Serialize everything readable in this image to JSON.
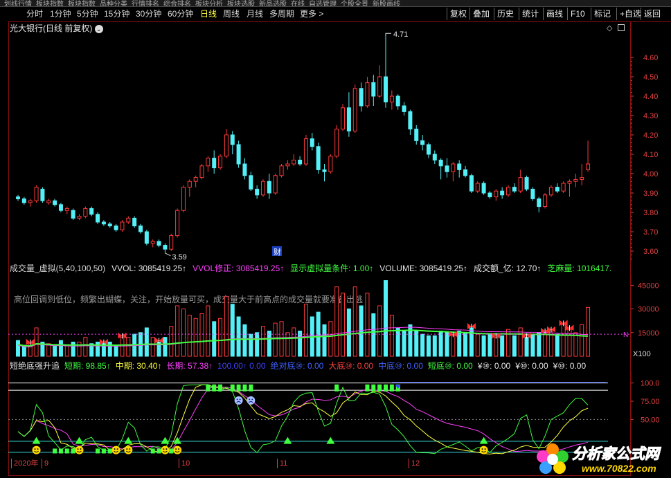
{
  "topbar": {
    "items": [
      "划线行情",
      "板块指数",
      "板块指数",
      "品种分类",
      "行情排名",
      "综合排名",
      "板块分析",
      "板块选股",
      "新品选股",
      "在线",
      "自选管理",
      "个股全景",
      "新股画线"
    ]
  },
  "period_bar": {
    "items": [
      "分时",
      "1分钟",
      "5分钟",
      "15分钟",
      "30分钟",
      "60分钟",
      "日线",
      "周线",
      "月线",
      "多周期",
      "更多 >"
    ],
    "active": "日线"
  },
  "right_buttons": [
    "复权",
    "叠加",
    "历史",
    "统计",
    "画线",
    "F10",
    "标记",
    "+自选",
    "返回"
  ],
  "main_panel": {
    "title": "光大银行(日线 前复权)",
    "high_label": "4.71",
    "low_label": "3.59",
    "badge": "财",
    "y_ticks": [
      "4.60",
      "4.50",
      "4.40",
      "4.30",
      "4.20",
      "4.10",
      "4.00",
      "3.90",
      "3.80",
      "3.70",
      "3.60"
    ]
  },
  "volume_panel": {
    "title_parts": [
      {
        "text": "成交量_虚拟(5,40,100,50)",
        "color": "#d8d8d8"
      },
      {
        "text": "VVOL: 3085419.25↑",
        "color": "#e8e8e8"
      },
      {
        "text": "VVOL修正: 3085419.25↑",
        "color": "#ff40ff"
      },
      {
        "text": "显示虚拟量条件: 1.00↑",
        "color": "#40ff40"
      },
      {
        "text": "VOLUME: 3085419.25↑",
        "color": "#e8e8e8"
      },
      {
        "text": "成交额_亿: 12.70↑",
        "color": "#e8e8e8"
      },
      {
        "text": "芝麻量: 1016417.",
        "color": "#40ff40"
      }
    ],
    "note": "高位回调到低位，频繁出蝴蝶，关注，开始放量可买，成交量大于前高点的成交量就要准备出逃",
    "y_ticks": [
      "45000",
      "30000",
      "15000"
    ],
    "unit": "X100",
    "marker": "N"
  },
  "indicator_panel": {
    "title_parts": [
      {
        "text": "短绝底强升追",
        "color": "#e8e8e8"
      },
      {
        "text": "短期: 98.85↑",
        "color": "#40ff40"
      },
      {
        "text": "中期: 30.40↑",
        "color": "#ffff40"
      },
      {
        "text": "长期: 57.38↑",
        "color": "#ff40ff"
      },
      {
        "text": "100.00↑ 0.00",
        "color": "#4040ff"
      },
      {
        "text": "绝对底⑩: 0.00",
        "color": "#4060ff"
      },
      {
        "text": "大底⑩: 0.00",
        "color": "#ff4040"
      },
      {
        "text": "中底⑩: 0.00",
        "color": "#4060ff"
      },
      {
        "text": "短底⑩: 0.00",
        "color": "#40ff40"
      },
      {
        "text": "¥⑩: 0.00",
        "color": "#e8e8e8"
      },
      {
        "text": "¥⑩: 0.00",
        "color": "#e8e8e8"
      },
      {
        "text": "¥⑩: 0.00",
        "color": "#e8e8e8"
      }
    ],
    "y_ticks": [
      "100.0",
      "75.00",
      "50.00"
    ]
  },
  "date_axis": {
    "labels": [
      "2020年",
      "9",
      "10",
      "11",
      "12"
    ]
  },
  "watermark": {
    "name": "分析家公式网",
    "url": "www.70822.com"
  },
  "colors": {
    "up": "#ff3b3b",
    "down": "#54f0f8",
    "frame": "#8a0f0f",
    "axis_text": "#e04040"
  },
  "chart_data": {
    "type": "candlestick",
    "ohlc": [
      [
        3.88,
        3.89,
        3.86,
        3.87
      ],
      [
        3.87,
        3.88,
        3.84,
        3.85
      ],
      [
        3.85,
        3.87,
        3.83,
        3.86
      ],
      [
        3.86,
        3.94,
        3.85,
        3.93
      ],
      [
        3.92,
        3.93,
        3.85,
        3.86
      ],
      [
        3.85,
        3.87,
        3.84,
        3.86
      ],
      [
        3.86,
        3.87,
        3.83,
        3.84
      ],
      [
        3.84,
        3.85,
        3.8,
        3.81
      ],
      [
        3.81,
        3.83,
        3.79,
        3.82
      ],
      [
        3.81,
        3.82,
        3.76,
        3.77
      ],
      [
        3.77,
        3.79,
        3.76,
        3.78
      ],
      [
        3.78,
        3.83,
        3.77,
        3.82
      ],
      [
        3.82,
        3.83,
        3.78,
        3.79
      ],
      [
        3.79,
        3.8,
        3.74,
        3.75
      ],
      [
        3.75,
        3.76,
        3.73,
        3.74
      ],
      [
        3.74,
        3.75,
        3.72,
        3.73
      ],
      [
        3.73,
        3.74,
        3.7,
        3.71
      ],
      [
        3.71,
        3.76,
        3.7,
        3.75
      ],
      [
        3.75,
        3.78,
        3.74,
        3.77
      ],
      [
        3.77,
        3.78,
        3.72,
        3.73
      ],
      [
        3.73,
        3.74,
        3.69,
        3.7
      ],
      [
        3.7,
        3.71,
        3.63,
        3.64
      ],
      [
        3.64,
        3.66,
        3.62,
        3.65
      ],
      [
        3.65,
        3.66,
        3.62,
        3.63
      ],
      [
        3.63,
        3.64,
        3.59,
        3.61
      ],
      [
        3.61,
        3.69,
        3.6,
        3.68
      ],
      [
        3.68,
        3.82,
        3.67,
        3.81
      ],
      [
        3.81,
        3.94,
        3.8,
        3.93
      ],
      [
        3.93,
        3.97,
        3.88,
        3.96
      ],
      [
        3.96,
        3.99,
        3.93,
        3.98
      ],
      [
        3.98,
        4.05,
        3.97,
        4.04
      ],
      [
        4.04,
        4.09,
        4.01,
        4.08
      ],
      [
        4.08,
        4.12,
        4.0,
        4.03
      ],
      [
        4.03,
        4.1,
        4.02,
        4.09
      ],
      [
        4.09,
        4.23,
        4.08,
        4.2
      ],
      [
        4.2,
        4.22,
        4.1,
        4.15
      ],
      [
        4.15,
        4.17,
        4.03,
        4.05
      ],
      [
        4.05,
        4.08,
        3.97,
        3.99
      ],
      [
        3.99,
        4.01,
        3.91,
        3.92
      ],
      [
        3.92,
        3.94,
        3.87,
        3.89
      ],
      [
        3.89,
        3.97,
        3.88,
        3.96
      ],
      [
        3.96,
        4.0,
        3.87,
        3.9
      ],
      [
        3.9,
        4.0,
        3.89,
        3.99
      ],
      [
        3.99,
        4.05,
        3.98,
        4.04
      ],
      [
        4.04,
        4.07,
        4.02,
        4.05
      ],
      [
        4.05,
        4.1,
        4.04,
        4.07
      ],
      [
        4.07,
        4.09,
        4.04,
        4.05
      ],
      [
        4.05,
        4.2,
        4.04,
        4.18
      ],
      [
        4.18,
        4.21,
        4.12,
        4.14
      ],
      [
        4.14,
        4.16,
        4.0,
        4.02
      ],
      [
        4.02,
        4.05,
        3.96,
        4.01
      ],
      [
        4.01,
        4.1,
        4.0,
        4.09
      ],
      [
        4.09,
        4.25,
        4.08,
        4.23
      ],
      [
        4.23,
        4.36,
        4.22,
        4.34
      ],
      [
        4.34,
        4.42,
        4.19,
        4.22
      ],
      [
        4.22,
        4.46,
        4.21,
        4.44
      ],
      [
        4.44,
        4.47,
        4.32,
        4.35
      ],
      [
        4.35,
        4.5,
        4.34,
        4.47
      ],
      [
        4.47,
        4.51,
        4.35,
        4.4
      ],
      [
        4.4,
        4.56,
        4.39,
        4.5
      ],
      [
        4.5,
        4.71,
        4.34,
        4.37
      ],
      [
        4.37,
        4.43,
        4.33,
        4.4
      ],
      [
        4.4,
        4.41,
        4.33,
        4.35
      ],
      [
        4.35,
        4.37,
        4.3,
        4.32
      ],
      [
        4.32,
        4.33,
        4.2,
        4.23
      ],
      [
        4.23,
        4.25,
        4.15,
        4.17
      ],
      [
        4.17,
        4.2,
        4.12,
        4.15
      ],
      [
        4.15,
        4.16,
        4.08,
        4.1
      ],
      [
        4.1,
        4.12,
        4.05,
        4.07
      ],
      [
        4.07,
        4.08,
        3.97,
        4.04
      ],
      [
        4.04,
        4.08,
        3.98,
        4.01
      ],
      [
        4.01,
        4.06,
        3.96,
        4.05
      ],
      [
        4.05,
        4.07,
        3.98,
        4.02
      ],
      [
        4.02,
        4.04,
        3.98,
        3.99
      ],
      [
        3.99,
        4.0,
        3.9,
        3.91
      ],
      [
        3.91,
        3.96,
        3.9,
        3.95
      ],
      [
        3.95,
        3.96,
        3.89,
        3.9
      ],
      [
        3.9,
        3.91,
        3.87,
        3.88
      ],
      [
        3.88,
        3.92,
        3.86,
        3.91
      ],
      [
        3.91,
        3.93,
        3.87,
        3.89
      ],
      [
        3.89,
        3.94,
        3.88,
        3.93
      ],
      [
        3.93,
        3.95,
        3.9,
        3.91
      ],
      [
        3.91,
        4.02,
        3.9,
        3.98
      ],
      [
        3.98,
        3.99,
        3.91,
        3.92
      ],
      [
        3.92,
        3.93,
        3.86,
        3.87
      ],
      [
        3.87,
        3.88,
        3.8,
        3.83
      ],
      [
        3.83,
        3.9,
        3.82,
        3.89
      ],
      [
        3.89,
        3.94,
        3.88,
        3.93
      ],
      [
        3.93,
        3.95,
        3.9,
        3.91
      ],
      [
        3.91,
        3.96,
        3.9,
        3.95
      ],
      [
        3.95,
        3.97,
        3.88,
        3.96
      ],
      [
        3.96,
        4.0,
        3.93,
        3.97
      ],
      [
        3.97,
        4.05,
        3.94,
        3.98
      ],
      [
        4.02,
        4.17,
        4.01,
        4.05
      ]
    ],
    "volume": [
      10000,
      7000,
      8000,
      18000,
      9000,
      8000,
      7000,
      10000,
      7000,
      9000,
      9000,
      12000,
      8000,
      9000,
      8000,
      9000,
      7000,
      12000,
      12000,
      14000,
      15000,
      18000,
      12000,
      9000,
      12000,
      19000,
      32000,
      30000,
      26000,
      24000,
      27000,
      32000,
      22000,
      24000,
      38000,
      33000,
      25000,
      20000,
      14000,
      15000,
      19000,
      16000,
      21000,
      22000,
      15000,
      18000,
      16000,
      33000,
      25000,
      28000,
      20000,
      22000,
      44000,
      40000,
      30000,
      44000,
      32000,
      40000,
      27000,
      32000,
      48000,
      26000,
      18000,
      16000,
      20000,
      16000,
      14000,
      13000,
      13000,
      16000,
      15000,
      13000,
      16000,
      15000,
      18000,
      14000,
      13000,
      14000,
      12000,
      13000,
      17000,
      13000,
      18000,
      12000,
      14000,
      15000,
      15000,
      16000,
      14000,
      20000,
      17000,
      15000,
      20000,
      31000
    ],
    "volume_ylim": [
      0,
      50000
    ],
    "ylim": [
      3.55,
      4.75
    ]
  }
}
